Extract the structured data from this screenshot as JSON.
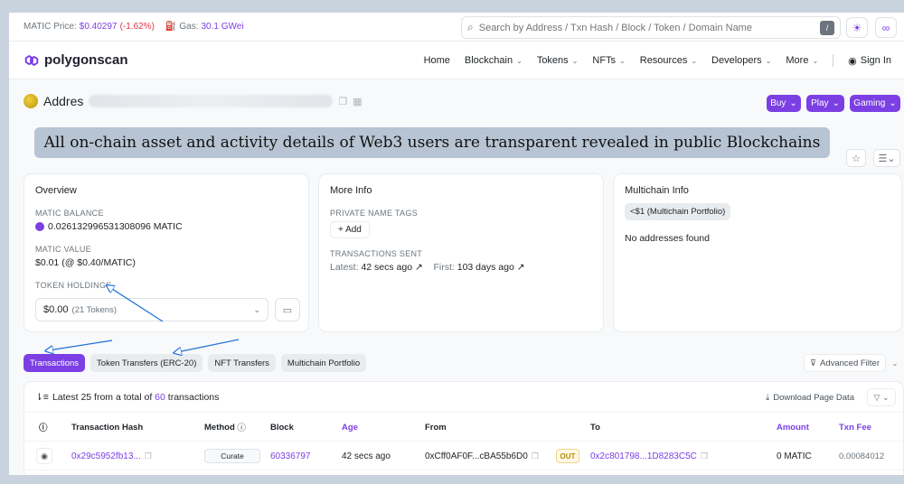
{
  "topbar": {
    "price_label": "MATIC Price:",
    "price_value": "$0.40297",
    "price_change": "(-1.62%)",
    "gas_label": "Gas:",
    "gas_value": "30.1 GWei",
    "search_placeholder": "Search by Address / Txn Hash / Block / Token / Domain Name",
    "search_shortcut": "/"
  },
  "navbar": {
    "logo_text": "polygonscan",
    "items": [
      {
        "label": "Home"
      },
      {
        "label": "Blockchain"
      },
      {
        "label": "Tokens"
      },
      {
        "label": "NFTs"
      },
      {
        "label": "Resources"
      },
      {
        "label": "Developers"
      },
      {
        "label": "More"
      }
    ],
    "signin": "Sign In"
  },
  "address": {
    "title": "Addres"
  },
  "promo": {
    "buy": "Buy",
    "play": "Play",
    "gaming": "Gaming"
  },
  "banner": {
    "text": "All on-chain asset and activity details of Web3 users are transparent revealed in public Blockchains"
  },
  "overview": {
    "title": "Overview",
    "balance_label": "MATIC BALANCE",
    "balance_value": "0.026132996531308096 MATIC",
    "value_label": "MATIC VALUE",
    "value_value": "$0.01 (@ $0.40/MATIC)",
    "holdings_label": "TOKEN HOLDINGS",
    "holdings_value": "$0.00",
    "holdings_count": "(21 Tokens)"
  },
  "more_info": {
    "title": "More Info",
    "tags_label": "PRIVATE NAME TAGS",
    "add_label": "Add",
    "sent_label": "TRANSACTIONS SENT",
    "latest_label": "Latest:",
    "latest_value": "42 secs ago",
    "first_label": "First:",
    "first_value": "103 days ago"
  },
  "multichain": {
    "title": "Multichain Info",
    "portfolio": "<$1 (Multichain Portfolio)",
    "none": "No addresses found"
  },
  "tabs": [
    {
      "label": "Transactions"
    },
    {
      "label": "Token Transfers (ERC-20)"
    },
    {
      "label": "NFT Transfers"
    },
    {
      "label": "Multichain Portfolio"
    }
  ],
  "advanced_filter": "Advanced Filter",
  "table": {
    "summary_prefix": "Latest 25 from a total of",
    "summary_count": "60",
    "summary_suffix": "transactions",
    "download": "Download Page Data",
    "columns": {
      "hash": "Transaction Hash",
      "method": "Method",
      "block": "Block",
      "age": "Age",
      "from": "From",
      "to": "To",
      "amount": "Amount",
      "fee": "Txn Fee"
    },
    "rows": [
      {
        "hash": "0x29c5952fb13...",
        "method": "Curate",
        "block": "60336797",
        "age": "42 secs ago",
        "from": "0xCff0AF0F...cBA55b6D0",
        "direction": "OUT",
        "to": "0x2c801798...1D8283C5C",
        "amount": "0 MATIC",
        "fee": "0.00084012"
      }
    ]
  },
  "colors": {
    "accent": "#7b3fe4",
    "annotation": "#1e6fd9",
    "negative": "#dc3545"
  }
}
